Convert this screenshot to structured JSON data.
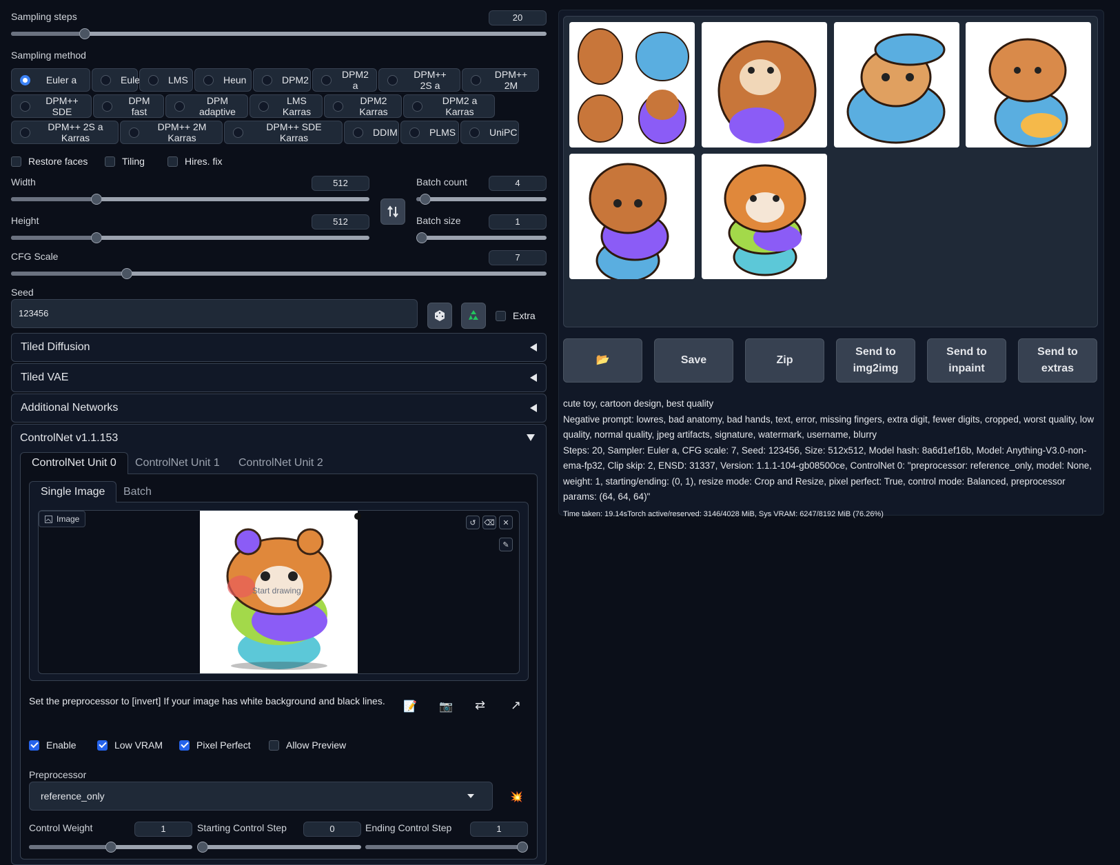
{
  "sampling_steps": {
    "label": "Sampling steps",
    "value": "20",
    "fraction": 0.13
  },
  "sampling_method": {
    "label": "Sampling method",
    "selected": "Euler a",
    "options": [
      "Euler a",
      "Euler",
      "LMS",
      "Heun",
      "DPM2",
      "DPM2 a",
      "DPM++ 2S a",
      "DPM++ 2M",
      "DPM++ SDE",
      "DPM fast",
      "DPM adaptive",
      "LMS Karras",
      "DPM2 Karras",
      "DPM2 a Karras",
      "DPM++ 2S a Karras",
      "DPM++ 2M Karras",
      "DPM++ SDE Karras",
      "DDIM",
      "PLMS",
      "UniPC"
    ]
  },
  "toggles": {
    "restore_faces": "Restore faces",
    "tiling": "Tiling",
    "hires_fix": "Hires. fix"
  },
  "width": {
    "label": "Width",
    "value": "512",
    "fraction": 0.23
  },
  "height": {
    "label": "Height",
    "value": "512",
    "fraction": 0.23
  },
  "batch_count": {
    "label": "Batch count",
    "value": "4",
    "fraction": 0.03
  },
  "batch_size": {
    "label": "Batch size",
    "value": "1",
    "fraction": 0.0
  },
  "cfg_scale": {
    "label": "CFG Scale",
    "value": "7",
    "fraction": 0.21
  },
  "seed": {
    "label": "Seed",
    "value": "123456",
    "extra_label": "Extra"
  },
  "accordions": {
    "tiled_diffusion": "Tiled Diffusion",
    "tiled_vae": "Tiled VAE",
    "additional_networks": "Additional Networks",
    "controlnet": "ControlNet v1.1.153"
  },
  "controlnet": {
    "units": [
      "ControlNet Unit 0",
      "ControlNet Unit 1",
      "ControlNet Unit 2"
    ],
    "image_tabs": [
      "Single Image",
      "Batch"
    ],
    "image_label": "Image",
    "canvas_hint": "Start drawing",
    "hint": "Set the preprocessor to [invert] If your image has white background and black lines.",
    "checks": {
      "enable": "Enable",
      "low_vram": "Low VRAM",
      "pixel_perfect": "Pixel Perfect",
      "allow_preview": "Allow Preview"
    },
    "preprocessor_label": "Preprocessor",
    "preprocessor_value": "reference_only",
    "control_weight": {
      "label": "Control Weight",
      "value": "1",
      "fraction": 0.5
    },
    "starting_step": {
      "label": "Starting Control Step",
      "value": "0",
      "fraction": 0.0
    },
    "ending_step": {
      "label": "Ending Control Step",
      "value": "1",
      "fraction": 1.0
    }
  },
  "output_buttons": {
    "folder": "📂",
    "save": "Save",
    "zip": "Zip",
    "img2img": "Send to img2img",
    "inpaint": "Send to inpaint",
    "extras": "Send to extras"
  },
  "generation_info": {
    "prompt": "cute toy, cartoon design, best quality",
    "negative": "Negative prompt: lowres, bad anatomy, bad hands, text, error, missing fingers, extra digit, fewer digits, cropped, worst quality, low quality, normal quality, jpeg artifacts, signature, watermark, username, blurry",
    "params": "Steps: 20, Sampler: Euler a, CFG scale: 7, Seed: 123456, Size: 512x512, Model hash: 8a6d1ef16b, Model: Anything-V3.0-non-ema-fp32, Clip skip: 2, ENSD: 31337, Version: 1.1.1-104-gb08500ce, ControlNet 0: \"preprocessor: reference_only, model: None, weight: 1, starting/ending: (0, 1), resize mode: Crop and Resize, pixel perfect: True, control mode: Balanced, preprocessor params: (64, 64, 64)\"",
    "timing": "Time taken: 19.14sTorch active/reserved: 3146/4028 MiB, Sys VRAM: 6247/8192 MiB (76.26%)"
  }
}
